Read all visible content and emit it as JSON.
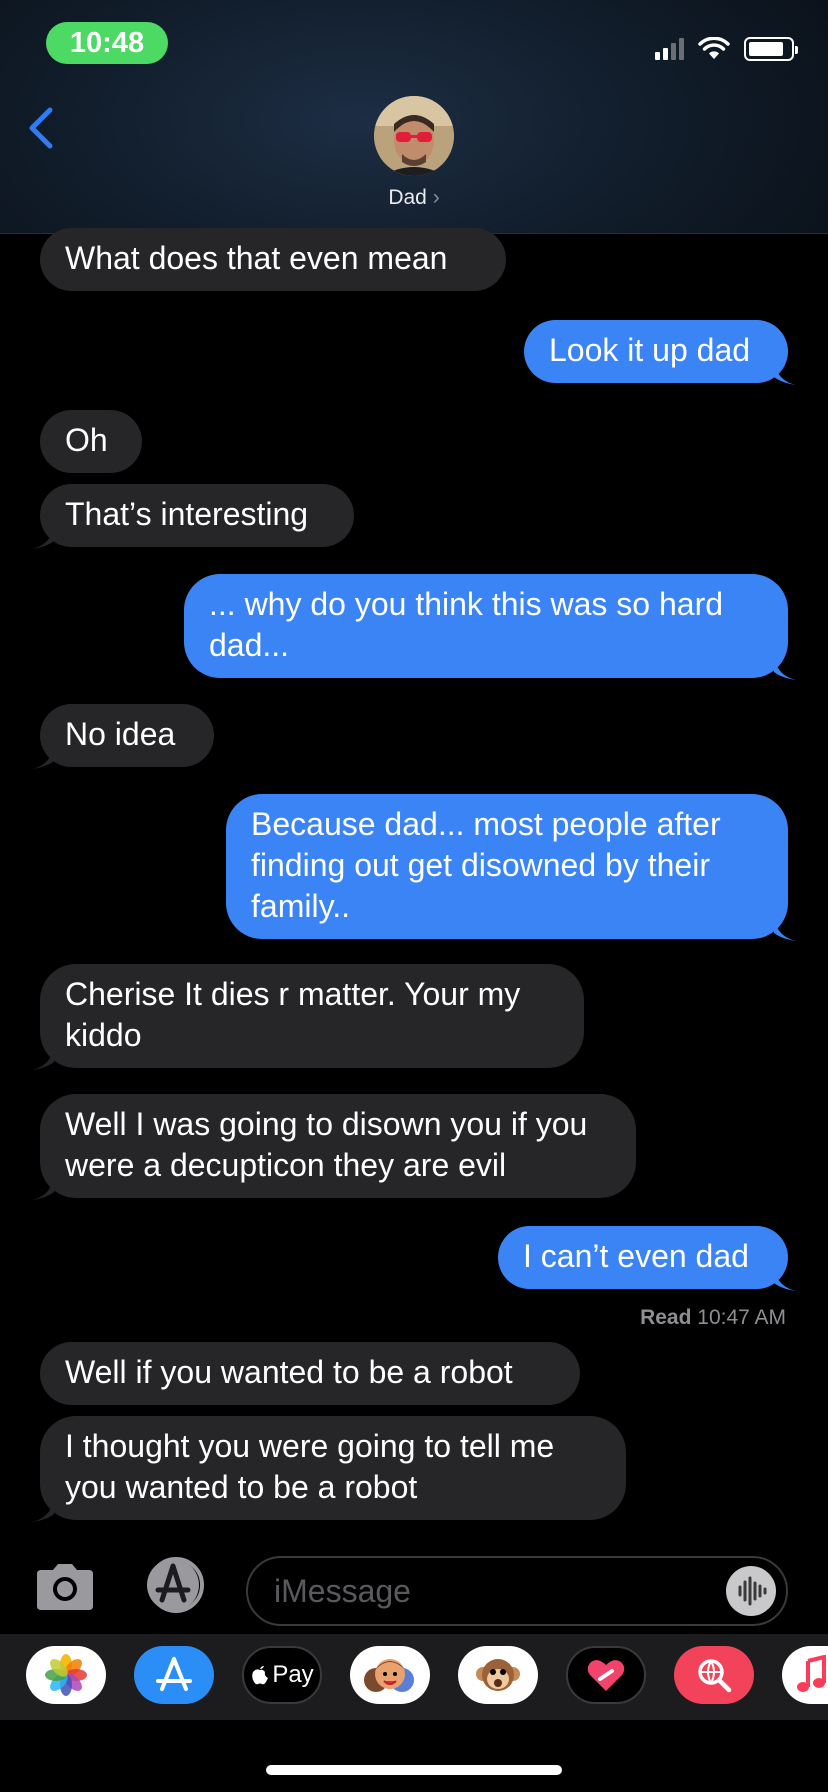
{
  "status_bar": {
    "time": "10:48"
  },
  "header": {
    "contact_name": "Dad",
    "chevron": "›"
  },
  "messages": [
    {
      "dir": "in",
      "text": "What does that even mean"
    },
    {
      "dir": "out",
      "text": "Look it up dad"
    },
    {
      "dir": "in",
      "text": "Oh"
    },
    {
      "dir": "in",
      "text": "That’s interesting"
    },
    {
      "dir": "out",
      "text": "... why do you think this was so hard dad..."
    },
    {
      "dir": "in",
      "text": "No idea"
    },
    {
      "dir": "out",
      "text": "Because dad... most people after finding out get disowned by their family.."
    },
    {
      "dir": "in",
      "text": "Cherise It dies r matter. Your my kiddo"
    },
    {
      "dir": "in",
      "text": "Well I was going to disown you if you were a decupticon they are evil"
    },
    {
      "dir": "out",
      "text": "I can’t even dad"
    },
    {
      "dir": "in",
      "text": "Well if you wanted to be a robot"
    },
    {
      "dir": "in",
      "text": "I thought you were going to tell me you wanted to be a robot"
    }
  ],
  "read_receipt": {
    "label": "Read",
    "time": "10:47 AM"
  },
  "input": {
    "placeholder": "iMessage"
  },
  "app_strip": {
    "items": [
      {
        "icon": "photos-icon"
      },
      {
        "icon": "app-store-icon"
      },
      {
        "icon": "apple-pay-icon",
        "label": "Pay"
      },
      {
        "icon": "memoji-icon"
      },
      {
        "icon": "animoji-icon"
      },
      {
        "icon": "digital-touch-icon"
      },
      {
        "icon": "gif-search-icon"
      },
      {
        "icon": "music-icon"
      }
    ]
  },
  "colors": {
    "outgoing_bubble": "#3b84f5",
    "incoming_bubble": "#262628",
    "status_pill": "#4cd964",
    "accent": "#2f7cf6"
  }
}
